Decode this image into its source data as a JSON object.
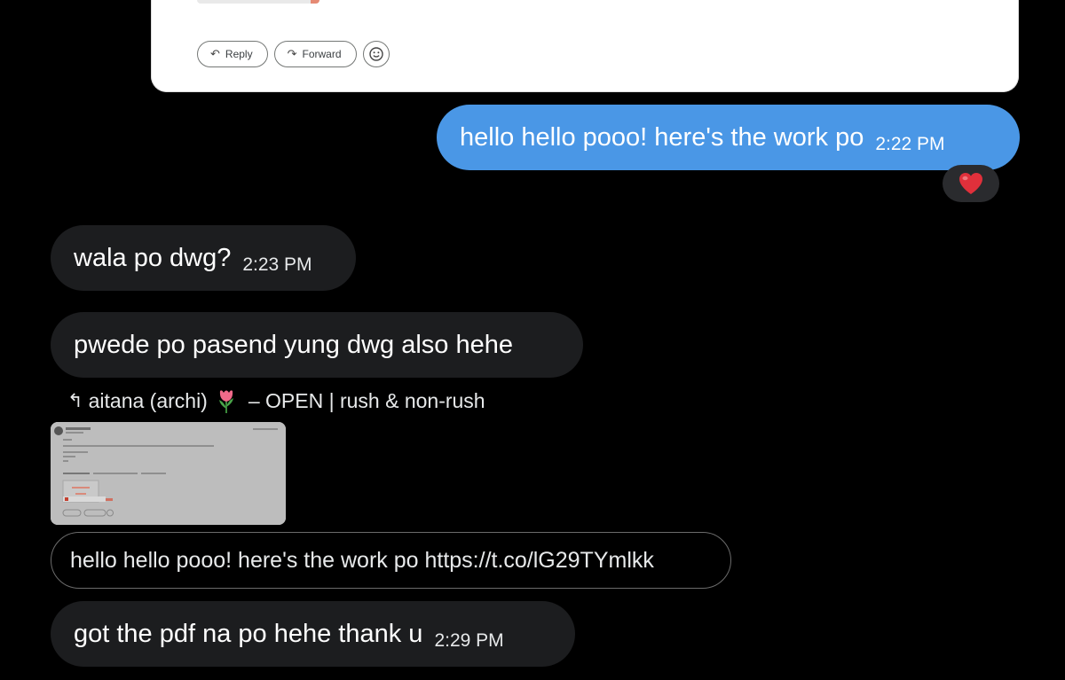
{
  "email": {
    "reply_label": "Reply",
    "forward_label": "Forward"
  },
  "messages": [
    {
      "text": "hello hello pooo! here's the work po",
      "time": "2:22 PM"
    },
    {
      "text": "wala po dwg?",
      "time": "2:23 PM"
    },
    {
      "text": "pwede po pasend yung dwg also hehe"
    },
    {
      "text": "hello hello pooo! here's the work po https://t.co/lG29TYmlkk"
    },
    {
      "text": "got the pdf na po hehe thank u",
      "time": "2:29 PM"
    }
  ],
  "reaction": "❤️",
  "quote": {
    "label_start": "aitana (archi)",
    "label_end": "– OPEN | rush & non-rush"
  },
  "colors": {
    "sent_bubble": "#4a97e6",
    "received_bubble": "#1c1d1f",
    "background": "#000000"
  }
}
